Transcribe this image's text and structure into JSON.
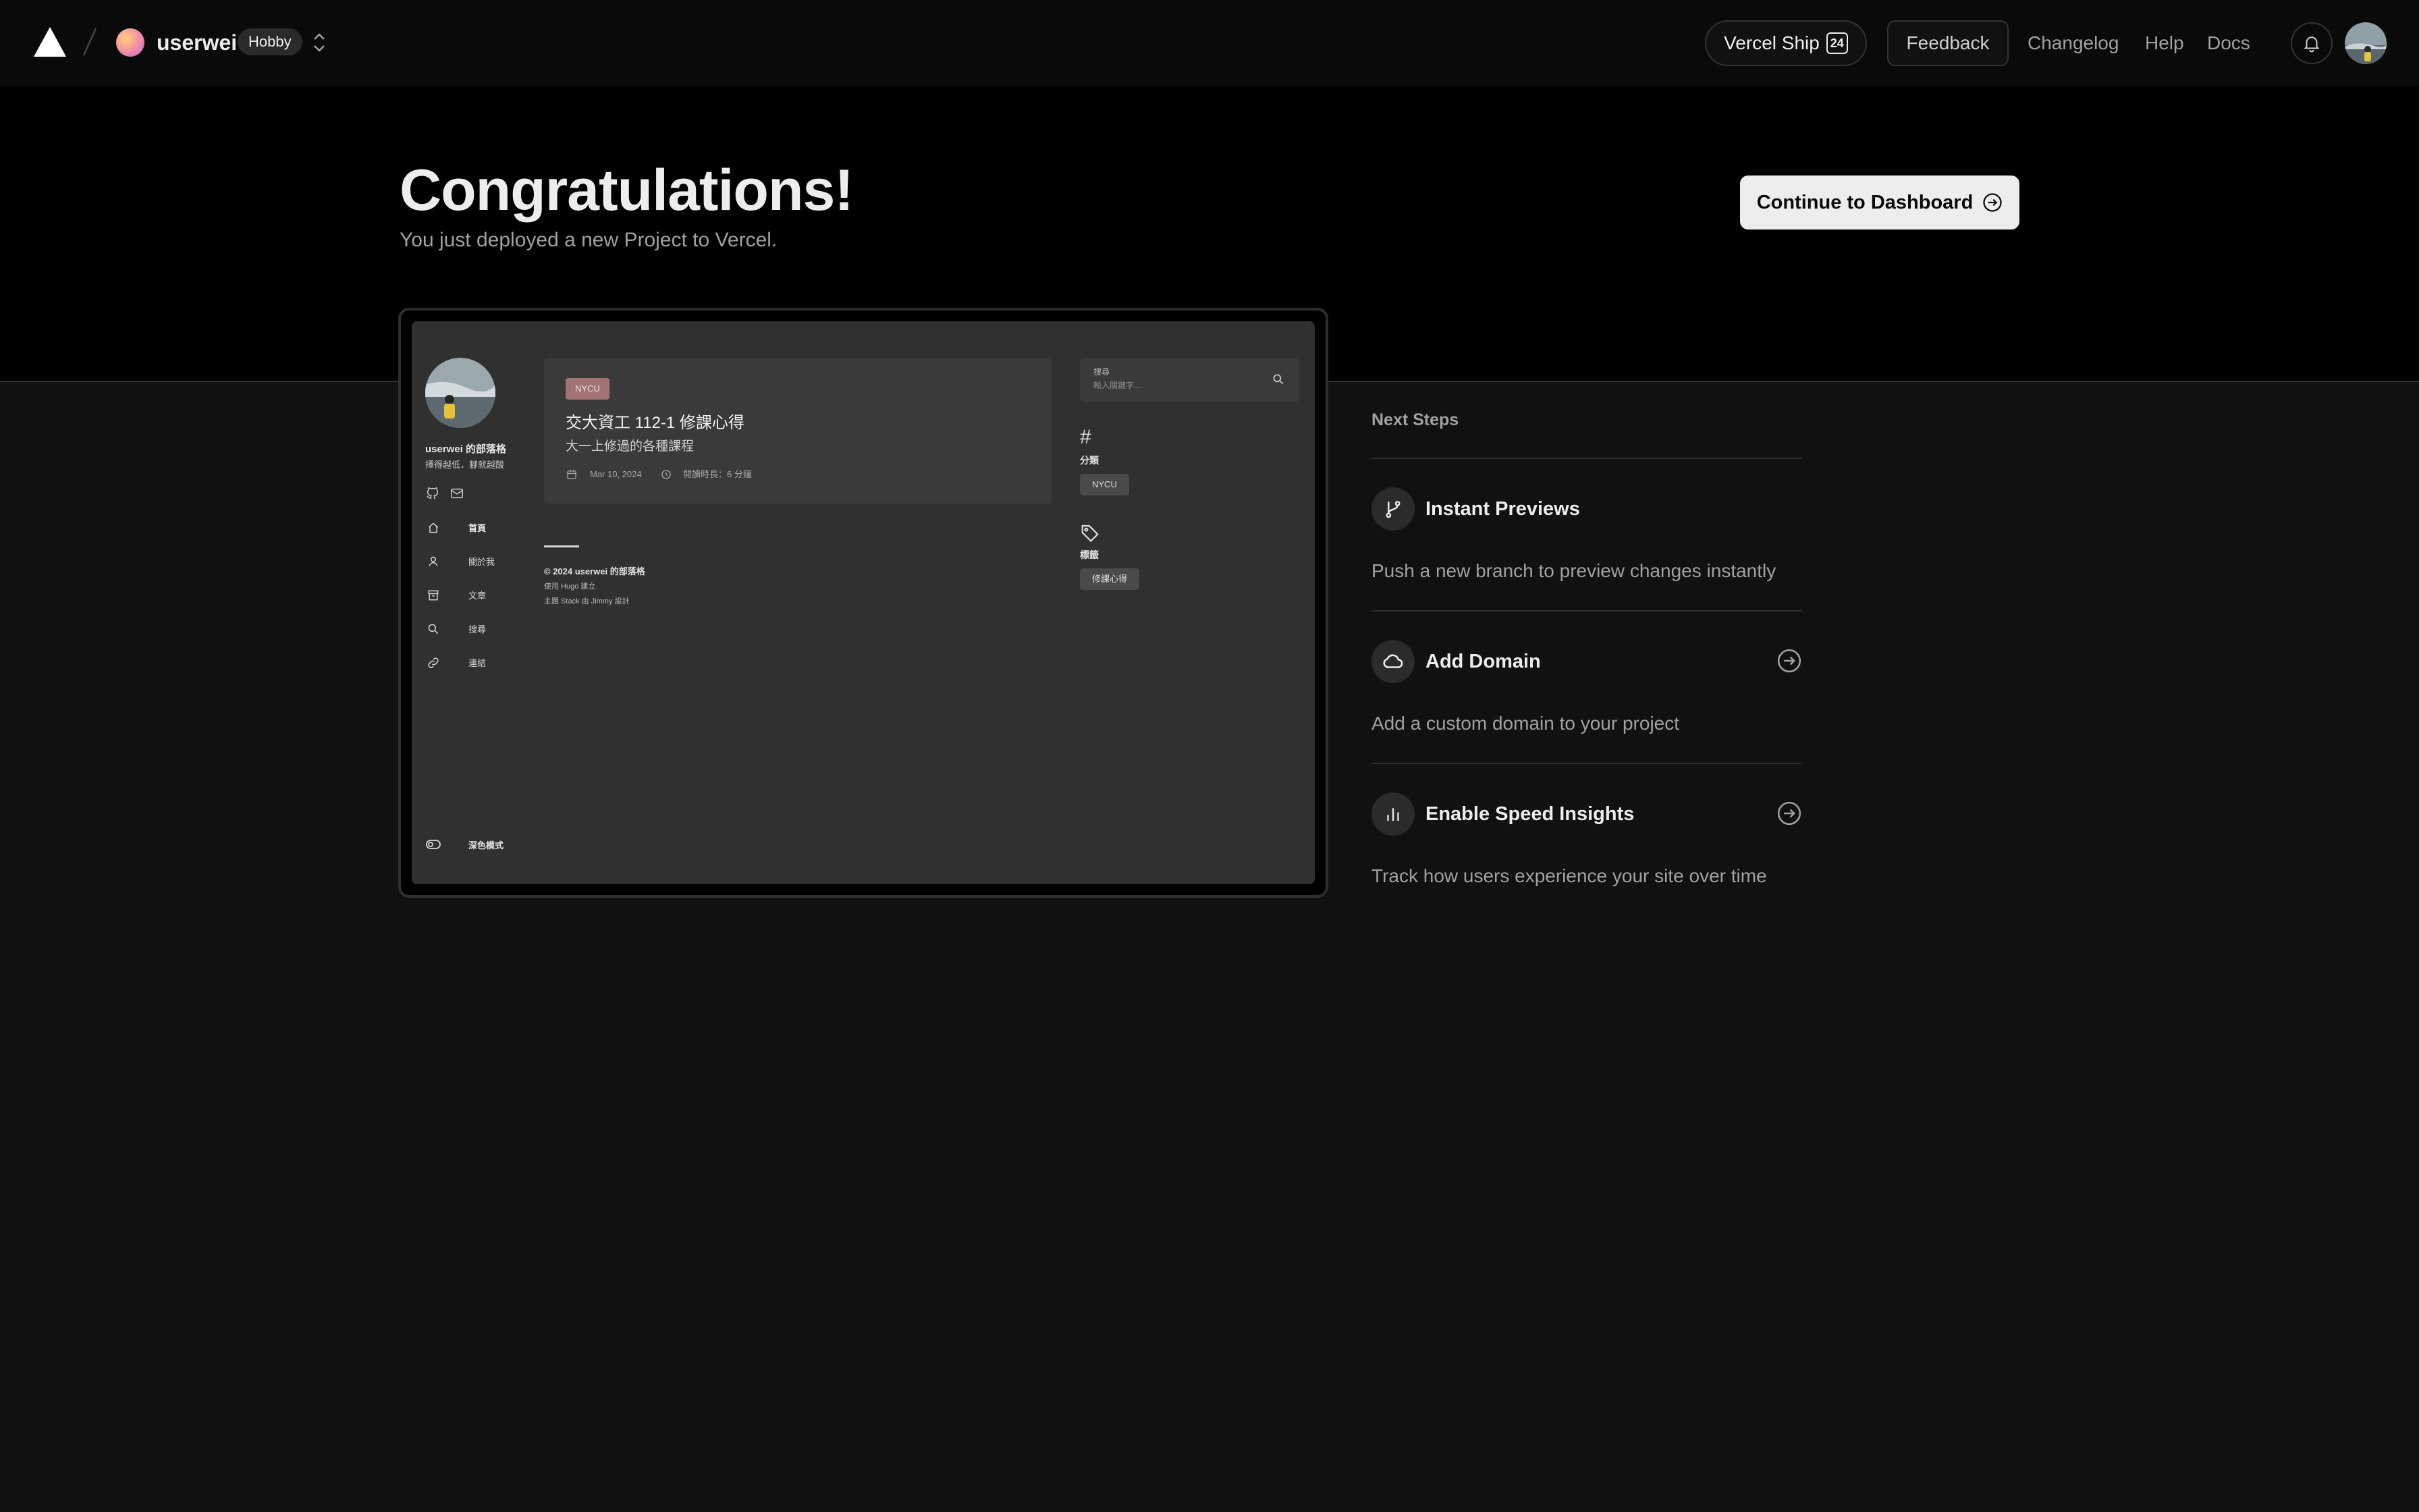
{
  "topbar": {
    "team_name": "userwei",
    "plan": "Hobby",
    "ship_label": "Vercel Ship",
    "ship_badge": "24",
    "feedback": "Feedback",
    "changelog": "Changelog",
    "help": "Help",
    "docs": "Docs"
  },
  "hero": {
    "title": "Congratulations!",
    "subtitle": "You just deployed a new Project to Vercel.",
    "continue": "Continue to Dashboard"
  },
  "preview": {
    "blog_name": "userwei 的部落格",
    "tagline": "擇得越低，腳就越酸",
    "nav": [
      {
        "label": "首頁",
        "icon": "home-icon"
      },
      {
        "label": "關於我",
        "icon": "user-icon"
      },
      {
        "label": "文章",
        "icon": "archive-icon"
      },
      {
        "label": "搜尋",
        "icon": "search-icon"
      },
      {
        "label": "連結",
        "icon": "link-icon"
      }
    ],
    "post": {
      "badge": "NYCU",
      "title": "交大資工 112-1 修課心得",
      "subtitle": "大一上修過的各種課程",
      "date": "Mar 10, 2024",
      "reading": "閱讀時長：6 分鐘"
    },
    "footer": {
      "copyright": "© 2024 userwei 的部落格",
      "built": "使用 Hugo 建立",
      "theme": "主題 Stack 由 Jimmy 設計"
    },
    "search": {
      "label": "搜尋",
      "placeholder": "輸入關鍵字..."
    },
    "categories": {
      "hash": "#",
      "title": "分類",
      "chip": "NYCU"
    },
    "tags": {
      "title": "標籤",
      "chip": "修課心得"
    },
    "dark_mode": "深色模式"
  },
  "next_steps": {
    "heading": "Next Steps",
    "items": [
      {
        "title": "Instant Previews",
        "desc": "Push a new branch to preview changes instantly",
        "icon": "git-branch-icon"
      },
      {
        "title": "Add Domain",
        "desc": "Add a custom domain to your project",
        "icon": "cloud-icon"
      },
      {
        "title": "Enable Speed Insights",
        "desc": "Track how users experience your site over time",
        "icon": "bar-chart-icon"
      }
    ]
  },
  "colors": {
    "accent_badge": "#a27372",
    "button_bg": "#ededed",
    "hero_bg": "#000000",
    "page_bg": "#111111"
  }
}
